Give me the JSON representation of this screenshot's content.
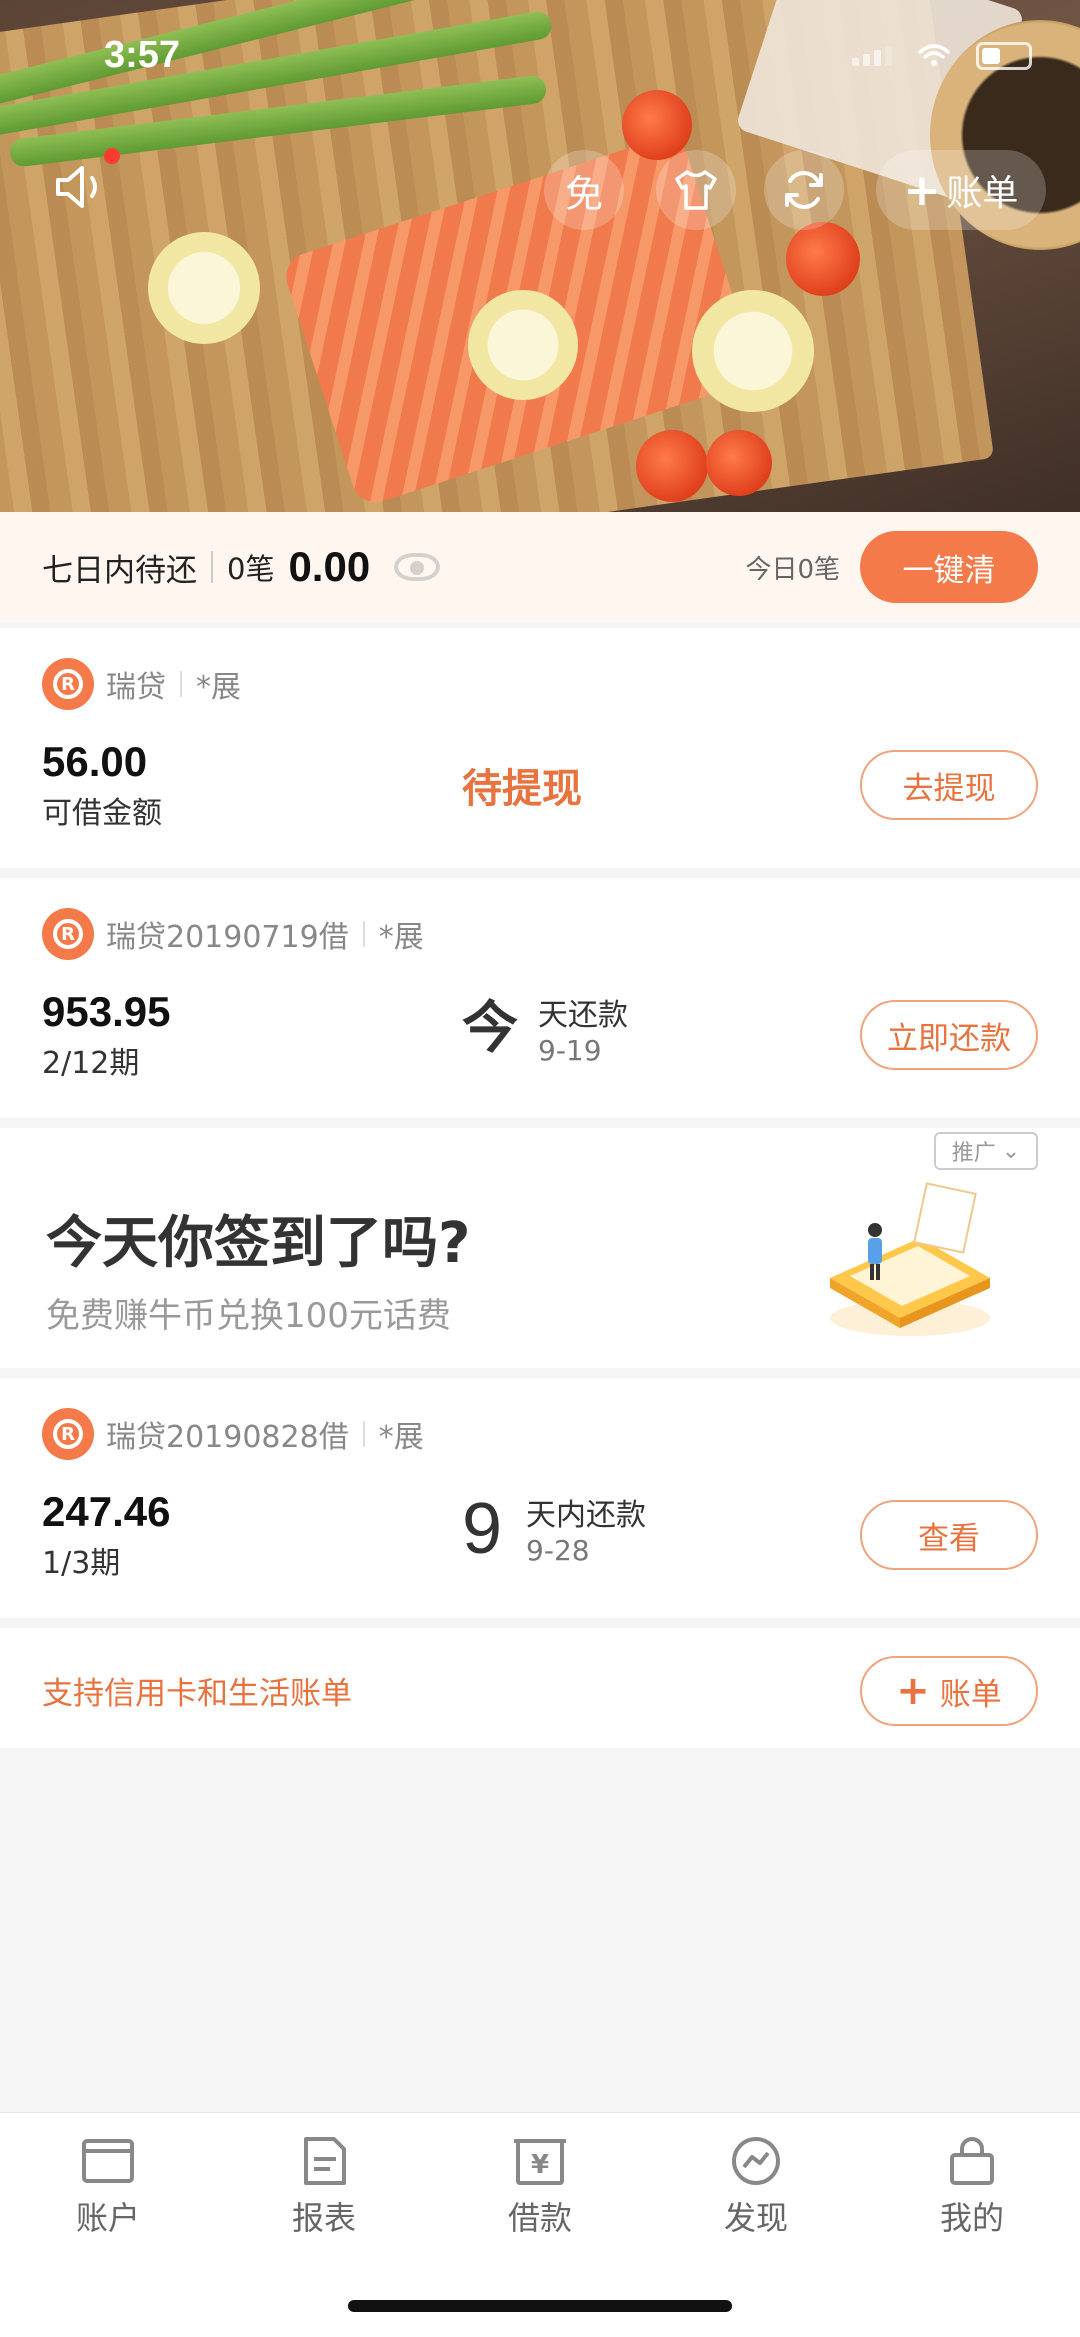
{
  "status_bar": {
    "time": "3:57"
  },
  "hero": {
    "btn_free": "免",
    "add_bill": "账单"
  },
  "summary": {
    "label": "七日内待还",
    "count": "0笔",
    "amount": "0.00",
    "today": "今日0笔",
    "action": "一键清"
  },
  "cards": [
    {
      "name": "瑞贷",
      "tag": "*展",
      "amount": "56.00",
      "sub": "可借金额",
      "status": "待提现",
      "action": "去提现"
    },
    {
      "name": "瑞贷20190719借",
      "tag": "*展",
      "amount": "953.95",
      "sub": "2/12期",
      "due_big": "今",
      "due_line1": "天还款",
      "due_line2": "9-19",
      "action": "立即还款"
    },
    {
      "name": "瑞贷20190828借",
      "tag": "*展",
      "amount": "247.46",
      "sub": "1/3期",
      "due_big": "9",
      "due_line1": "天内还款",
      "due_line2": "9-28",
      "action": "查看"
    }
  ],
  "ad": {
    "tag": "推广",
    "title": "今天你签到了吗?",
    "subtitle": "免费赚牛币兑换100元话费"
  },
  "bill_row": {
    "text": "支持信用卡和生活账单",
    "action": "账单"
  },
  "tabs": [
    {
      "label": "账户",
      "icon": "account-icon"
    },
    {
      "label": "报表",
      "icon": "report-icon"
    },
    {
      "label": "借款",
      "icon": "loan-icon"
    },
    {
      "label": "发现",
      "icon": "discover-icon"
    },
    {
      "label": "我的",
      "icon": "profile-icon"
    }
  ],
  "colors": {
    "accent": "#f57a4a",
    "accent_text": "#e8733f"
  }
}
